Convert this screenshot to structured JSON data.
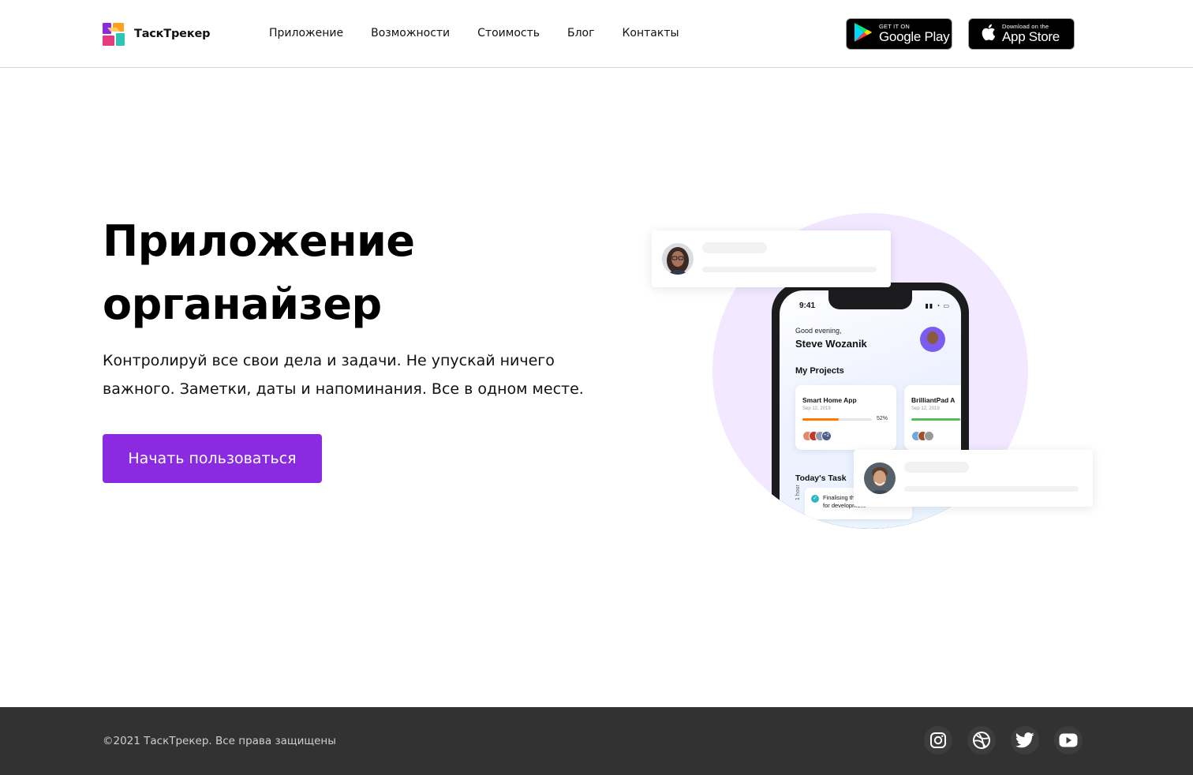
{
  "header": {
    "brand": "ТаскТрекер",
    "nav": [
      "Приложение",
      "Возможности",
      "Стоимость",
      "Блог",
      "Контакты"
    ],
    "google_play": {
      "small": "GET IT ON",
      "big": "Google Play"
    },
    "app_store": {
      "small": "Download on the",
      "big": "App Store"
    }
  },
  "hero": {
    "title_line1": "Приложение",
    "title_line2": "органайзер",
    "subtitle": "Контролируй все свои дела и задачи. Не упускай ничего важного. Заметки, даты и напоминания. Все в одном месте.",
    "cta": "Начать пользоваться"
  },
  "phone": {
    "time": "9:41",
    "greeting": "Good evening,",
    "user": "Steve Wozanik",
    "projects_title": "My Projects",
    "projects": [
      {
        "title": "Smart Home App",
        "date": "Sep 12, 2019",
        "progress": "52%",
        "extra": "+2"
      },
      {
        "title": "BrilliantPad A",
        "date": "Sep 12, 2019"
      }
    ],
    "today_title": "Today's Task",
    "task": "Finalising the\nfor development",
    "hour": "1 hour"
  },
  "footer": {
    "copyright": "©2021 ТаскТрекер. Все права защищены",
    "social": [
      "instagram",
      "dribbble",
      "twitter",
      "youtube"
    ]
  },
  "colors": {
    "accent": "#8a2be2",
    "footer_bg": "#323232",
    "circle": "#f2e8ff"
  }
}
